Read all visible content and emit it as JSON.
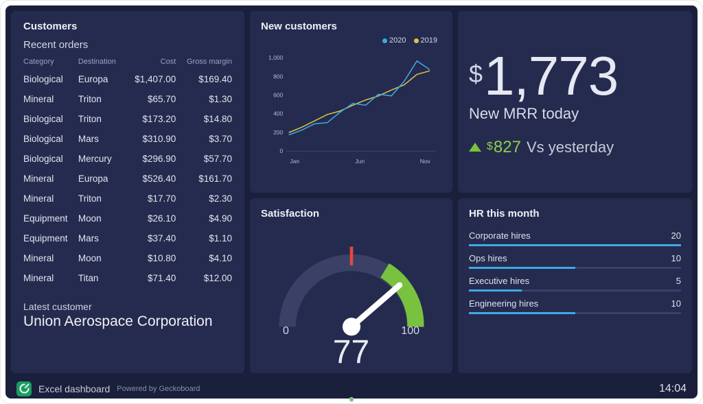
{
  "newCustomers": {
    "title": "New customers",
    "legend": {
      "s1": "2020",
      "s2": "2019"
    }
  },
  "mrr": {
    "currency": "$",
    "value": "1,773",
    "label": "New MRR today",
    "deltaCurrency": "$",
    "deltaValue": "827",
    "deltaSuffix": "Vs yesterday"
  },
  "customers": {
    "title": "Customers",
    "sub": "Recent orders",
    "cols": {
      "c1": "Category",
      "c2": "Destination",
      "c3": "Cost",
      "c4": "Gross margin"
    },
    "rows": [
      {
        "cat": "Biological",
        "dest": "Europa",
        "cost": "$1,407.00",
        "gm": "$169.40"
      },
      {
        "cat": "Mineral",
        "dest": "Triton",
        "cost": "$65.70",
        "gm": "$1.30"
      },
      {
        "cat": "Biological",
        "dest": "Triton",
        "cost": "$173.20",
        "gm": "$14.80"
      },
      {
        "cat": "Biological",
        "dest": "Mars",
        "cost": "$310.90",
        "gm": "$3.70"
      },
      {
        "cat": "Biological",
        "dest": "Mercury",
        "cost": "$296.90",
        "gm": "$57.70"
      },
      {
        "cat": "Mineral",
        "dest": "Europa",
        "cost": "$526.40",
        "gm": "$161.70"
      },
      {
        "cat": "Mineral",
        "dest": "Triton",
        "cost": "$17.70",
        "gm": "$2.30"
      },
      {
        "cat": "Equipment",
        "dest": "Moon",
        "cost": "$26.10",
        "gm": "$4.90"
      },
      {
        "cat": "Equipment",
        "dest": "Mars",
        "cost": "$37.40",
        "gm": "$1.10"
      },
      {
        "cat": "Mineral",
        "dest": "Moon",
        "cost": "$10.80",
        "gm": "$4.10"
      },
      {
        "cat": "Mineral",
        "dest": "Titan",
        "cost": "$71.40",
        "gm": "$12.00"
      }
    ],
    "latestLabel": "Latest customer",
    "latestValue": "Union Aerospace Corporation"
  },
  "satisfaction": {
    "title": "Satisfaction",
    "min": "0",
    "max": "100",
    "value": "77"
  },
  "hr": {
    "title": "HR this month",
    "rows": [
      {
        "label": "Corporate hires",
        "value": "20",
        "pct": 100
      },
      {
        "label": "Ops hires",
        "value": "10",
        "pct": 50
      },
      {
        "label": "Executive hires",
        "value": "5",
        "pct": 25
      },
      {
        "label": "Engineering hires",
        "value": "10",
        "pct": 50
      }
    ]
  },
  "footer": {
    "title": "Excel dashboard",
    "powered": "Powered by Geckoboard",
    "clock": "14:04"
  },
  "chart_data": [
    {
      "type": "line",
      "title": "New customers",
      "xlabel": "",
      "ylabel": "",
      "ylim": [
        0,
        1000
      ],
      "y_ticks": [
        0,
        200,
        400,
        600,
        800,
        1000
      ],
      "x_ticks_shown": [
        "Jan",
        "Jun",
        "Nov"
      ],
      "categories": [
        "Jan",
        "Feb",
        "Mar",
        "Apr",
        "May",
        "Jun",
        "Jul",
        "Aug",
        "Sep",
        "Oct",
        "Nov",
        "Dec"
      ],
      "series": [
        {
          "name": "2020",
          "color": "#3fa9e6",
          "values": [
            180,
            230,
            300,
            310,
            420,
            520,
            500,
            620,
            600,
            760,
            980,
            880
          ]
        },
        {
          "name": "2019",
          "color": "#d7c648",
          "values": [
            200,
            260,
            330,
            400,
            440,
            500,
            560,
            600,
            660,
            720,
            830,
            870
          ]
        }
      ]
    },
    {
      "type": "gauge",
      "title": "Satisfaction",
      "min": 0,
      "max": 100,
      "value": 77,
      "red_marker_at": 50,
      "green_band": [
        70,
        100
      ]
    },
    {
      "type": "bar",
      "title": "HR this month",
      "orientation": "horizontal",
      "categories": [
        "Corporate hires",
        "Ops hires",
        "Executive hires",
        "Engineering hires"
      ],
      "values": [
        20,
        10,
        5,
        10
      ],
      "xlim": [
        0,
        20
      ]
    }
  ]
}
